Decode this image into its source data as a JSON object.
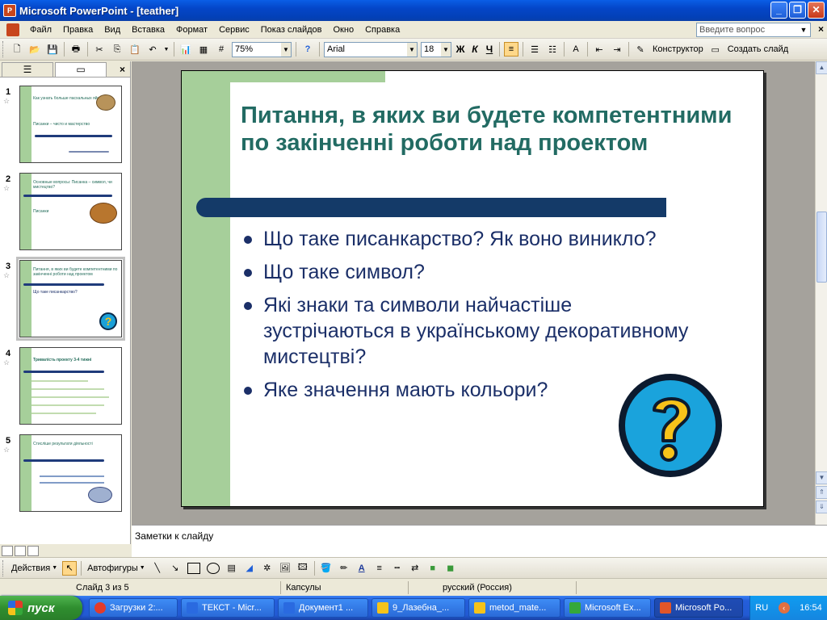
{
  "window": {
    "title": "Microsoft PowerPoint - [teather]",
    "app_icon_letter": "P"
  },
  "menu": {
    "items": [
      "Файл",
      "Правка",
      "Вид",
      "Вставка",
      "Формат",
      "Сервис",
      "Показ слайдов",
      "Окно",
      "Справка"
    ],
    "help_placeholder": "Введите вопрос"
  },
  "toolbar": {
    "zoom": "75%",
    "font": "Arial",
    "font_size": "18",
    "bold": "Ж",
    "italic": "К",
    "underline": "Ч",
    "designer_label": "Конструктор",
    "new_slide_label": "Создать слайд"
  },
  "thumbnails": [
    {
      "num": "1",
      "title": "Как узнать больше пасхальных яйцах",
      "sub": "Писанки – чисто и мастерство"
    },
    {
      "num": "2",
      "title": "Основные вопросы: Писанка – символ, чи мистецтво?",
      "sub": "Писанки"
    },
    {
      "num": "3",
      "title": "Питання, в яких ви будете компетентними по закінченні роботи над проектом",
      "sub": "Що таке писанкарство?"
    },
    {
      "num": "4",
      "title": "Тривалість проекту 3-4 тижні",
      "sub": ""
    },
    {
      "num": "5",
      "title": "Стисліше результати діяльності",
      "sub": ""
    }
  ],
  "slide": {
    "title": "Питання, в яких ви будете компетентними по закінченні роботи над проектом",
    "bullets": [
      "Що таке писанкарство? Як воно виникло?",
      "Що таке символ?",
      "Які знаки та символи найчастіше зустрічаються в українському декоративному мистецтві?",
      "Яке значення мають кольори?"
    ],
    "colors": {
      "title": "#226b63",
      "body": "#1b2f68",
      "green": "#a6cf9a",
      "bar": "#143a68"
    }
  },
  "notes": {
    "placeholder": "Заметки к слайду"
  },
  "drawbar": {
    "actions_label": "Действия",
    "autoshapes_label": "Автофигуры"
  },
  "status": {
    "slide_info": "Слайд 3 из 5",
    "design": "Капсулы",
    "language": "русский (Россия)"
  },
  "taskbar": {
    "start_label": "пуск",
    "tasks": [
      {
        "label": "Загрузки 2:...",
        "color": "#e33b2a"
      },
      {
        "label": "ТЕКСТ - Micr...",
        "color": "#2a6ae0"
      },
      {
        "label": "Документ1 ...",
        "color": "#2a6ae0"
      },
      {
        "label": "9_Лазебна_...",
        "color": "#f5c31a"
      },
      {
        "label": "metod_mate...",
        "color": "#f5c31a"
      },
      {
        "label": "Microsoft Ex...",
        "color": "#35a83a"
      },
      {
        "label": "Microsoft Po...",
        "color": "#e0562a"
      }
    ],
    "lang": "RU",
    "clock": "16:54"
  }
}
